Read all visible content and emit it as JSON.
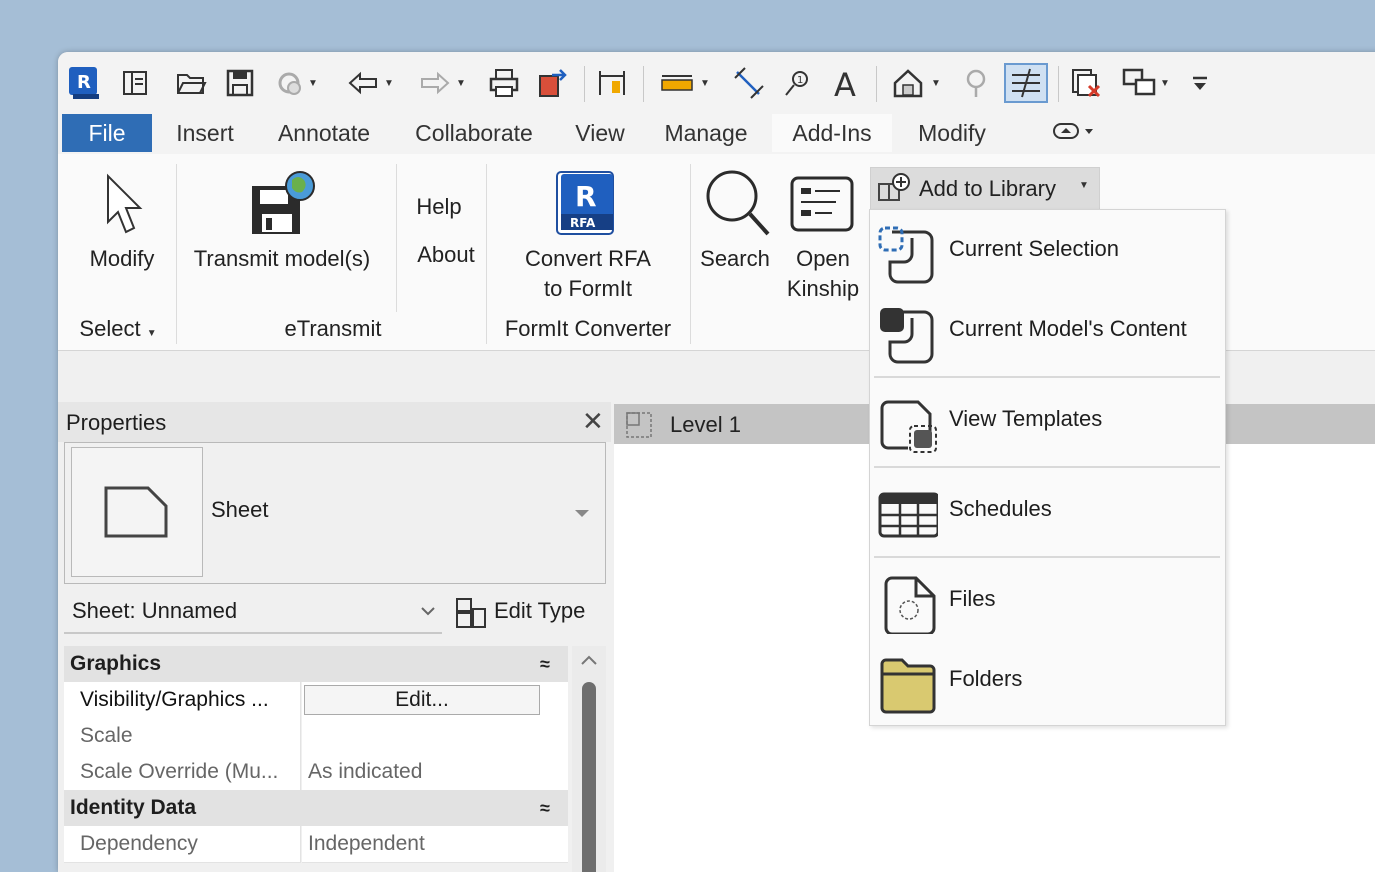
{
  "tabs": [
    "File",
    "Insert",
    "Annotate",
    "Collaborate",
    "View",
    "Manage",
    "Add-Ins",
    "Modify"
  ],
  "ribbon": {
    "modify_label": "Modify",
    "select_label": "Select",
    "transmit_label": "Transmit model(s)",
    "etransmit_group": "eTransmit",
    "help_label": "Help",
    "about_label": "About",
    "convert_line1": "Convert RFA",
    "convert_line2": "to FormIt",
    "rfa_badge": "RFA",
    "formit_group": "FormIt Converter",
    "search_label": "Search",
    "open_line1": "Open",
    "open_line2": "Kinship",
    "add_to_library": "Add to Library"
  },
  "dropdown": {
    "items": [
      "Current Selection",
      "Current Model's Content",
      "View Templates",
      "Schedules",
      "Files",
      "Folders"
    ]
  },
  "properties": {
    "title": "Properties",
    "type_name": "Sheet",
    "instance": "Sheet: Unnamed",
    "edit_type": "Edit Type",
    "categories": [
      "Graphics",
      "Identity Data"
    ],
    "rows": [
      {
        "name": "Visibility/Graphics ...",
        "value": "Edit..."
      },
      {
        "name": "Scale",
        "value": ""
      },
      {
        "name": "Scale Override (Mu...",
        "value": "As indicated"
      },
      {
        "name": "Dependency",
        "value": "Independent"
      }
    ]
  },
  "view": {
    "tab_label": "Level 1"
  },
  "colors": {
    "file_tab": "#2f6db5",
    "accent": "#2f6db5",
    "folder": "#d9c970"
  }
}
